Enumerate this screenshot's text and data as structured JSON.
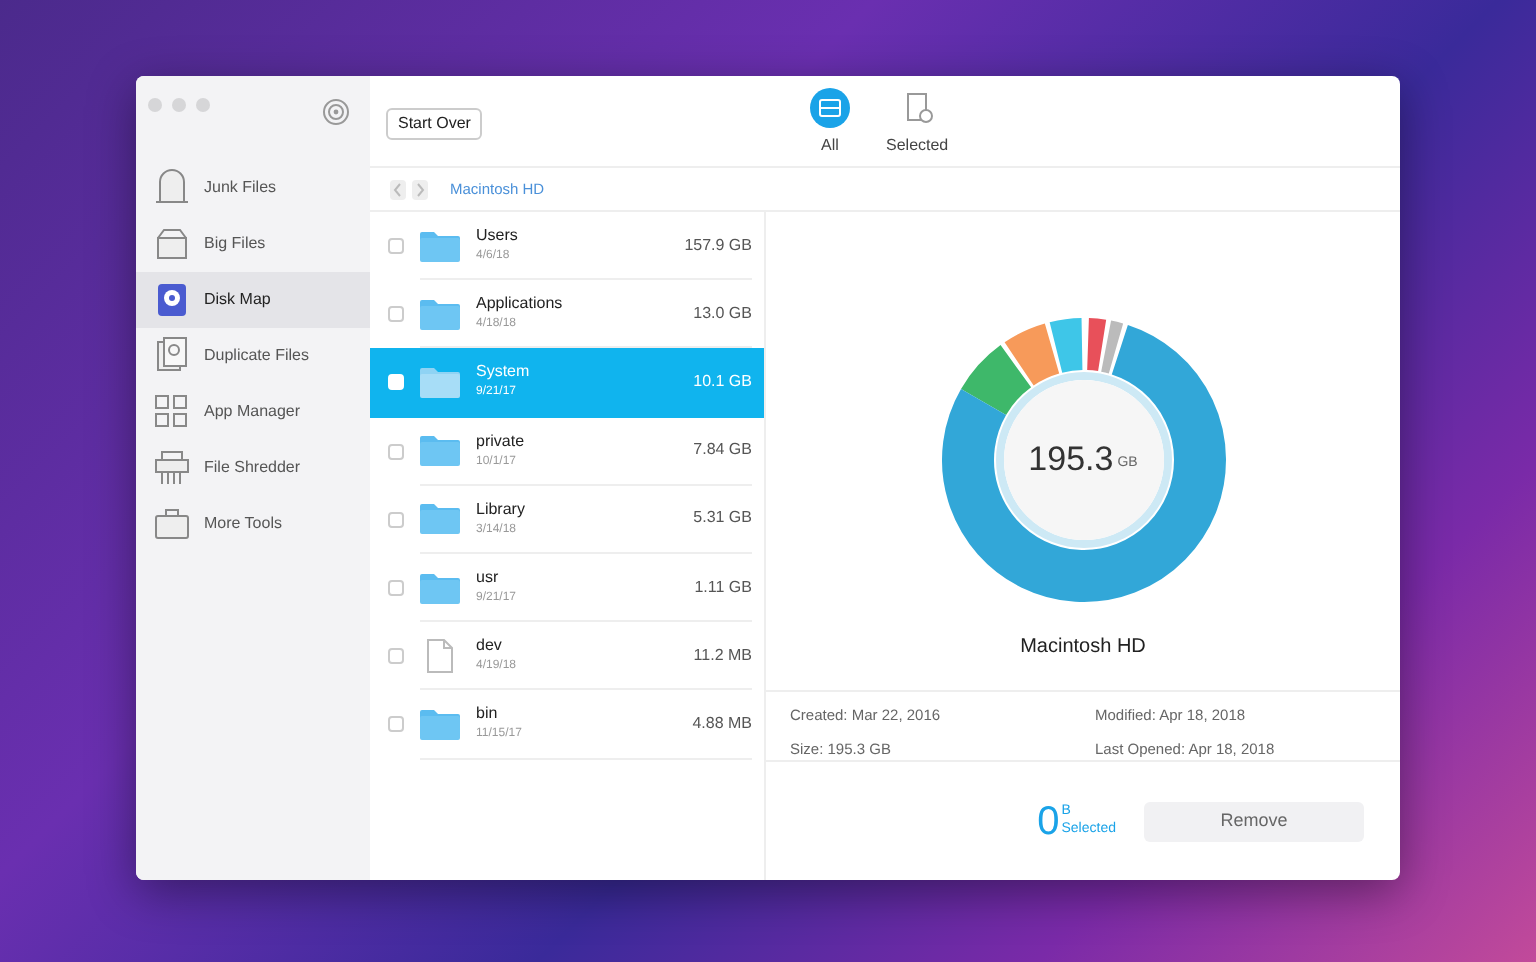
{
  "sidebar": {
    "items": [
      {
        "label": "Junk Files",
        "selected": false
      },
      {
        "label": "Big Files",
        "selected": false
      },
      {
        "label": "Disk Map",
        "selected": true
      },
      {
        "label": "Duplicate Files",
        "selected": false
      },
      {
        "label": "App Manager",
        "selected": false
      },
      {
        "label": "File Shredder",
        "selected": false
      },
      {
        "label": "More Tools",
        "selected": false
      }
    ]
  },
  "toolbar": {
    "start_over": "Start Over",
    "tabs": [
      {
        "label": "All",
        "selected": true
      },
      {
        "label": "Selected",
        "selected": false
      }
    ]
  },
  "breadcrumb": "Macintosh HD",
  "files": [
    {
      "name": "Users",
      "date": "4/6/18",
      "size": "157.9 GB",
      "kind": "folder",
      "checked": false,
      "selected": false
    },
    {
      "name": "Applications",
      "date": "4/18/18",
      "size": "13.0 GB",
      "kind": "folder",
      "checked": false,
      "selected": false
    },
    {
      "name": "System",
      "date": "9/21/17",
      "size": "10.1 GB",
      "kind": "folder",
      "checked": false,
      "selected": true
    },
    {
      "name": "private",
      "date": "10/1/17",
      "size": "7.84 GB",
      "kind": "folder",
      "checked": false,
      "selected": false
    },
    {
      "name": "Library",
      "date": "3/14/18",
      "size": "5.31 GB",
      "kind": "folder",
      "checked": false,
      "selected": false
    },
    {
      "name": "usr",
      "date": "9/21/17",
      "size": "1.11 GB",
      "kind": "folder",
      "checked": false,
      "selected": false
    },
    {
      "name": "dev",
      "date": "4/19/18",
      "size": "11.2 MB",
      "kind": "file",
      "checked": false,
      "selected": false
    },
    {
      "name": "bin",
      "date": "11/15/17",
      "size": "4.88 MB",
      "kind": "folder",
      "checked": false,
      "selected": false
    }
  ],
  "disk": {
    "total": "195.3",
    "unit": "GB",
    "name": "Macintosh HD",
    "details": [
      "Created: Mar 22, 2016",
      "Modified: Apr 18, 2018",
      "Size: 195.3 GB",
      "Last Opened: Apr 18, 2018"
    ]
  },
  "footer": {
    "count": "0",
    "unit": "B",
    "label": "Selected",
    "remove": "Remove"
  }
}
